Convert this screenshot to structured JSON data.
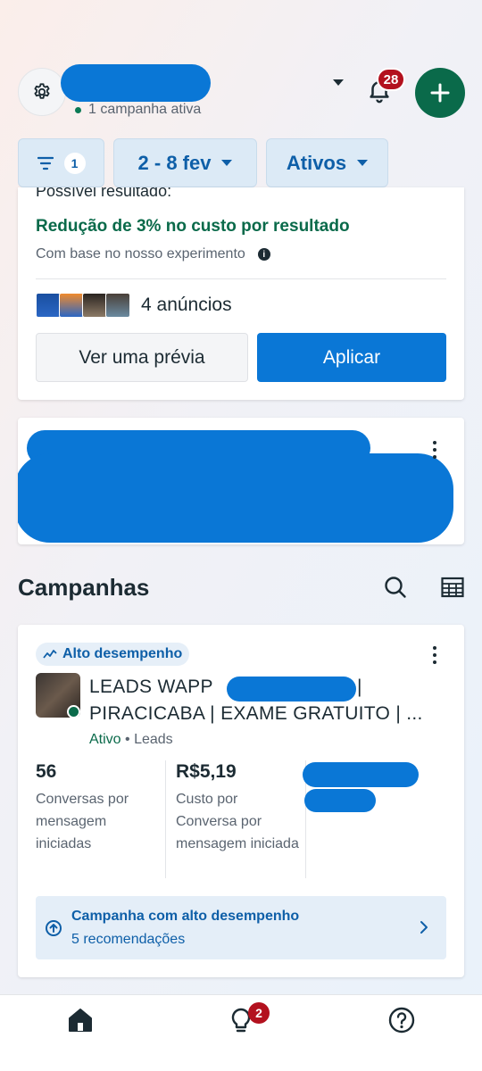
{
  "header": {
    "status_text": "1 campanha ativa",
    "notifications_count": "28"
  },
  "filters": {
    "filter_count": "1",
    "date_range": "2 - 8 fev",
    "status_filter": "Ativos"
  },
  "recommendation_card": {
    "cut_text": "Possível resultado:",
    "headline": "Redução de 3% no custo por resultado",
    "subtext": "Com base no nosso experimento",
    "ads_count_label": "4 anúncios",
    "preview_button": "Ver uma prévia",
    "apply_button": "Aplicar"
  },
  "campaigns_section": {
    "title": "Campanhas"
  },
  "campaign_card": {
    "badge": "Alto desempenho",
    "name_line1": "LEADS WAPP",
    "name_separator": "|",
    "name_line2": "PIRACICABA | EXAME GRATUITO | ...",
    "status": "Ativo",
    "objective": "• Leads",
    "metric1_value": "56",
    "metric1_label": "Conversas por mensagem iniciadas",
    "metric2_value": "R$5,19",
    "metric2_label": "Custo por Conversa por mensagem iniciada",
    "banner_title": "Campanha com alto desempenho",
    "banner_subtitle": "5 recomendações"
  },
  "bottom_nav": {
    "recommendations_badge": "2"
  },
  "colors": {
    "brand_blue": "#0a77d6",
    "success_green": "#0a6a4a",
    "badge_red": "#b3111e"
  }
}
